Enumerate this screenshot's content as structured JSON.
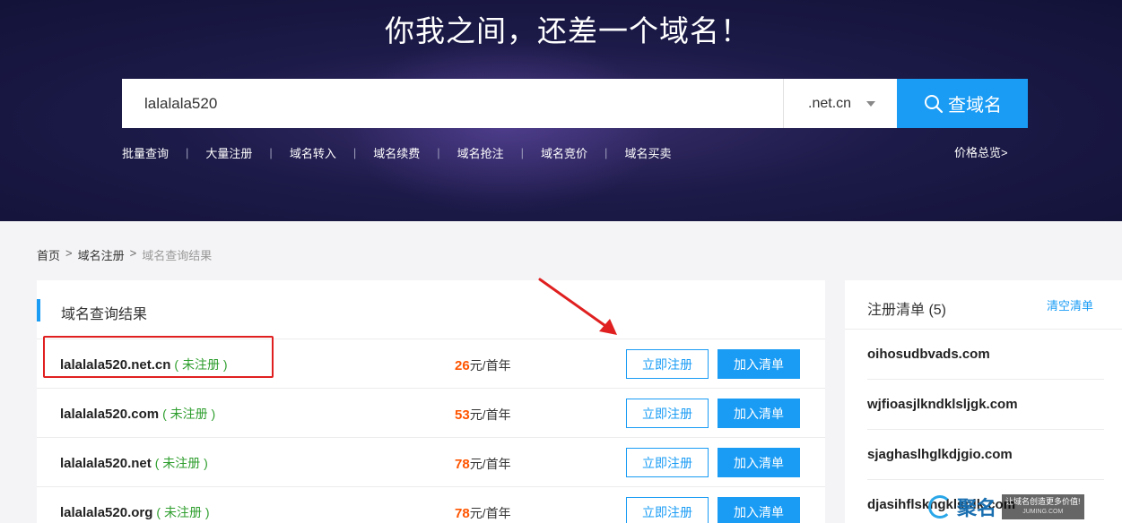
{
  "hero": {
    "title": "你我之间，还差一个域名！",
    "search_value": "lalalala520",
    "suffix": ".net.cn",
    "search_button": "查域名",
    "subnav": [
      "批量查询",
      "大量注册",
      "域名转入",
      "域名续费",
      "域名抢注",
      "域名竞价",
      "域名买卖"
    ],
    "price_link": "价格总览>"
  },
  "breadcrumb": {
    "home": "首页",
    "sep": ">",
    "register": "域名注册",
    "current": "域名查询结果"
  },
  "results": {
    "title": "域名查询结果",
    "register_label": "立即注册",
    "add_label": "加入清单",
    "price_unit": "元/首年",
    "rows": [
      {
        "domain": "lalalala520.net.cn",
        "status": "( 未注册 )",
        "price": "26"
      },
      {
        "domain": "lalalala520.com",
        "status": "( 未注册 )",
        "price": "53"
      },
      {
        "domain": "lalalala520.net",
        "status": "( 未注册 )",
        "price": "78"
      },
      {
        "domain": "lalalala520.org",
        "status": "( 未注册 )",
        "price": "78"
      }
    ]
  },
  "cart": {
    "title": "注册清单 (5)",
    "clear": "清空清单",
    "items": [
      "oihosudbvads.com",
      "wjfioasjlkndklsljgk.com",
      "sjaghaslhglkdjgio.com",
      "djasihflskngklsnlk.com"
    ]
  },
  "watermark": {
    "brand": "聚名",
    "slogan": "让域名创造更多价值!",
    "site": "JUMING.COM"
  },
  "colors": {
    "accent": "#1a9cf5",
    "price": "#ff5500",
    "status": "#2e9e2e",
    "annotation": "#e02020"
  }
}
